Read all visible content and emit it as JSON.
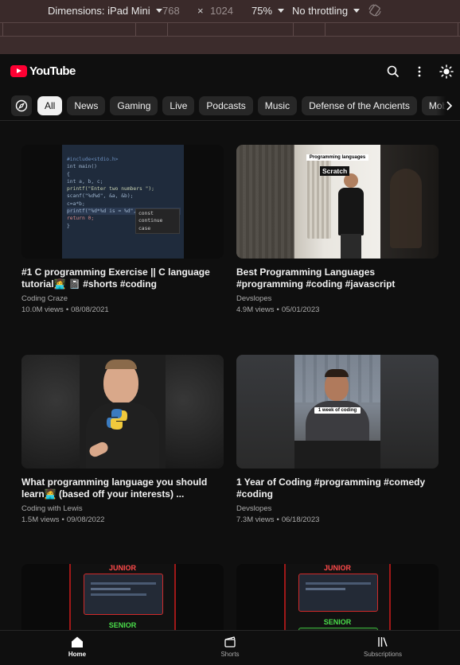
{
  "devtools": {
    "device": "Dimensions: iPad Mini",
    "width": "768",
    "times": "×",
    "height": "1024",
    "zoom": "75%",
    "throttle": "No throttling"
  },
  "header": {
    "logo_text": "YouTube"
  },
  "chips": [
    "All",
    "News",
    "Gaming",
    "Live",
    "Podcasts",
    "Music",
    "Defense of the Ancients",
    "Mobile Legends"
  ],
  "videos": [
    {
      "title": "#1 C programming Exercise || C language tutorial👩‍💻 📓 #shorts #coding",
      "channel": "Coding Craze",
      "views": "10.0M views",
      "date": "08/08/2021",
      "thumb_code": [
        "#include<stdio.h>",
        "int main()",
        "{",
        "  int a, b, c;",
        "  printf(\"Enter two numbers \");",
        "  scanf(\"%d%d\", &a, &b);",
        "  c=a*b;",
        "  printf(\"%d*%d is = %d\", a, b, c);",
        "  return 0;",
        "}"
      ],
      "thumb_suggest": [
        "const",
        "continue",
        "case"
      ]
    },
    {
      "title": "Best Programming Languages #programming #coding #javascript",
      "channel": "Devslopes",
      "views": "4.9M views",
      "date": "05/01/2023",
      "thumb_caption": "Programming languages",
      "thumb_word": "Scratch"
    },
    {
      "title": "What programming language you should learn🧑‍💻 (based off your interests) ...",
      "channel": "Coding with Lewis",
      "views": "1.5M views",
      "date": "09/08/2022"
    },
    {
      "title": "1 Year of Coding #programming #comedy #coding",
      "channel": "Devslopes",
      "views": "7.3M views",
      "date": "06/18/2023",
      "thumb_caption": "1 week of coding"
    }
  ],
  "partial_thumbs": [
    {
      "top_label": "JUNIOR",
      "bottom_label": "SENIOR"
    },
    {
      "top_label": "JUNIOR",
      "bottom_label": "SENIOR"
    }
  ],
  "bottom_nav": [
    {
      "label": "Home",
      "icon": "home-icon"
    },
    {
      "label": "Shorts",
      "icon": "shorts-icon"
    },
    {
      "label": "Subscriptions",
      "icon": "subscriptions-icon"
    }
  ],
  "colors": {
    "brand": "#ff0033",
    "background": "#0f0f0f",
    "chip": "#272727",
    "active_chip": "#f1f1f1",
    "junior": "#ff4a4a",
    "senior": "#4ade4a"
  }
}
